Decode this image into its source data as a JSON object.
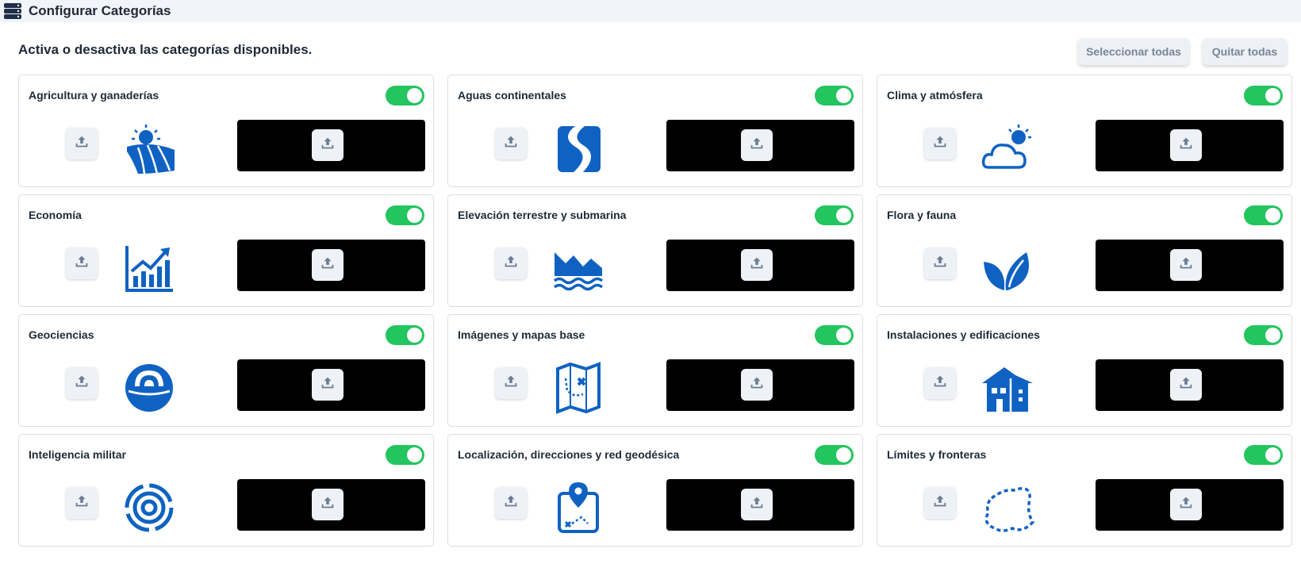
{
  "header": {
    "title": "Configurar Categorías",
    "icon": "server-stack-icon"
  },
  "toolbar": {
    "subtitle": "Activa o desactiva las categorías disponibles.",
    "select_all_label": "Seleccionar todas",
    "remove_all_label": "Quitar todas"
  },
  "colors": {
    "accent": "#0f62c2",
    "toggle_on": "#22c55e",
    "preview_panel": "#000000"
  },
  "categories": [
    {
      "label": "Agricultura y ganaderías",
      "icon": "agriculture-field-sun-icon",
      "enabled": true
    },
    {
      "label": "Aguas continentales",
      "icon": "river-icon",
      "enabled": true
    },
    {
      "label": "Clima y atmósfera",
      "icon": "cloud-sun-icon",
      "enabled": true
    },
    {
      "label": "Economía",
      "icon": "growth-chart-icon",
      "enabled": true
    },
    {
      "label": "Elevación terrestre y submarina",
      "icon": "mountains-waves-icon",
      "enabled": true
    },
    {
      "label": "Flora y fauna",
      "icon": "leaves-icon",
      "enabled": true
    },
    {
      "label": "Geociencias",
      "icon": "geoscience-dome-icon",
      "enabled": true
    },
    {
      "label": "Imágenes y mapas base",
      "icon": "treasure-map-icon",
      "enabled": true
    },
    {
      "label": "Instalaciones y edificaciones",
      "icon": "buildings-icon",
      "enabled": true
    },
    {
      "label": "Inteligencia militar",
      "icon": "target-icon",
      "enabled": true
    },
    {
      "label": "Localización, direcciones y red geodésica",
      "icon": "map-pin-route-icon",
      "enabled": true
    },
    {
      "label": "Límites y fronteras",
      "icon": "dashed-border-region-icon",
      "enabled": true
    }
  ]
}
